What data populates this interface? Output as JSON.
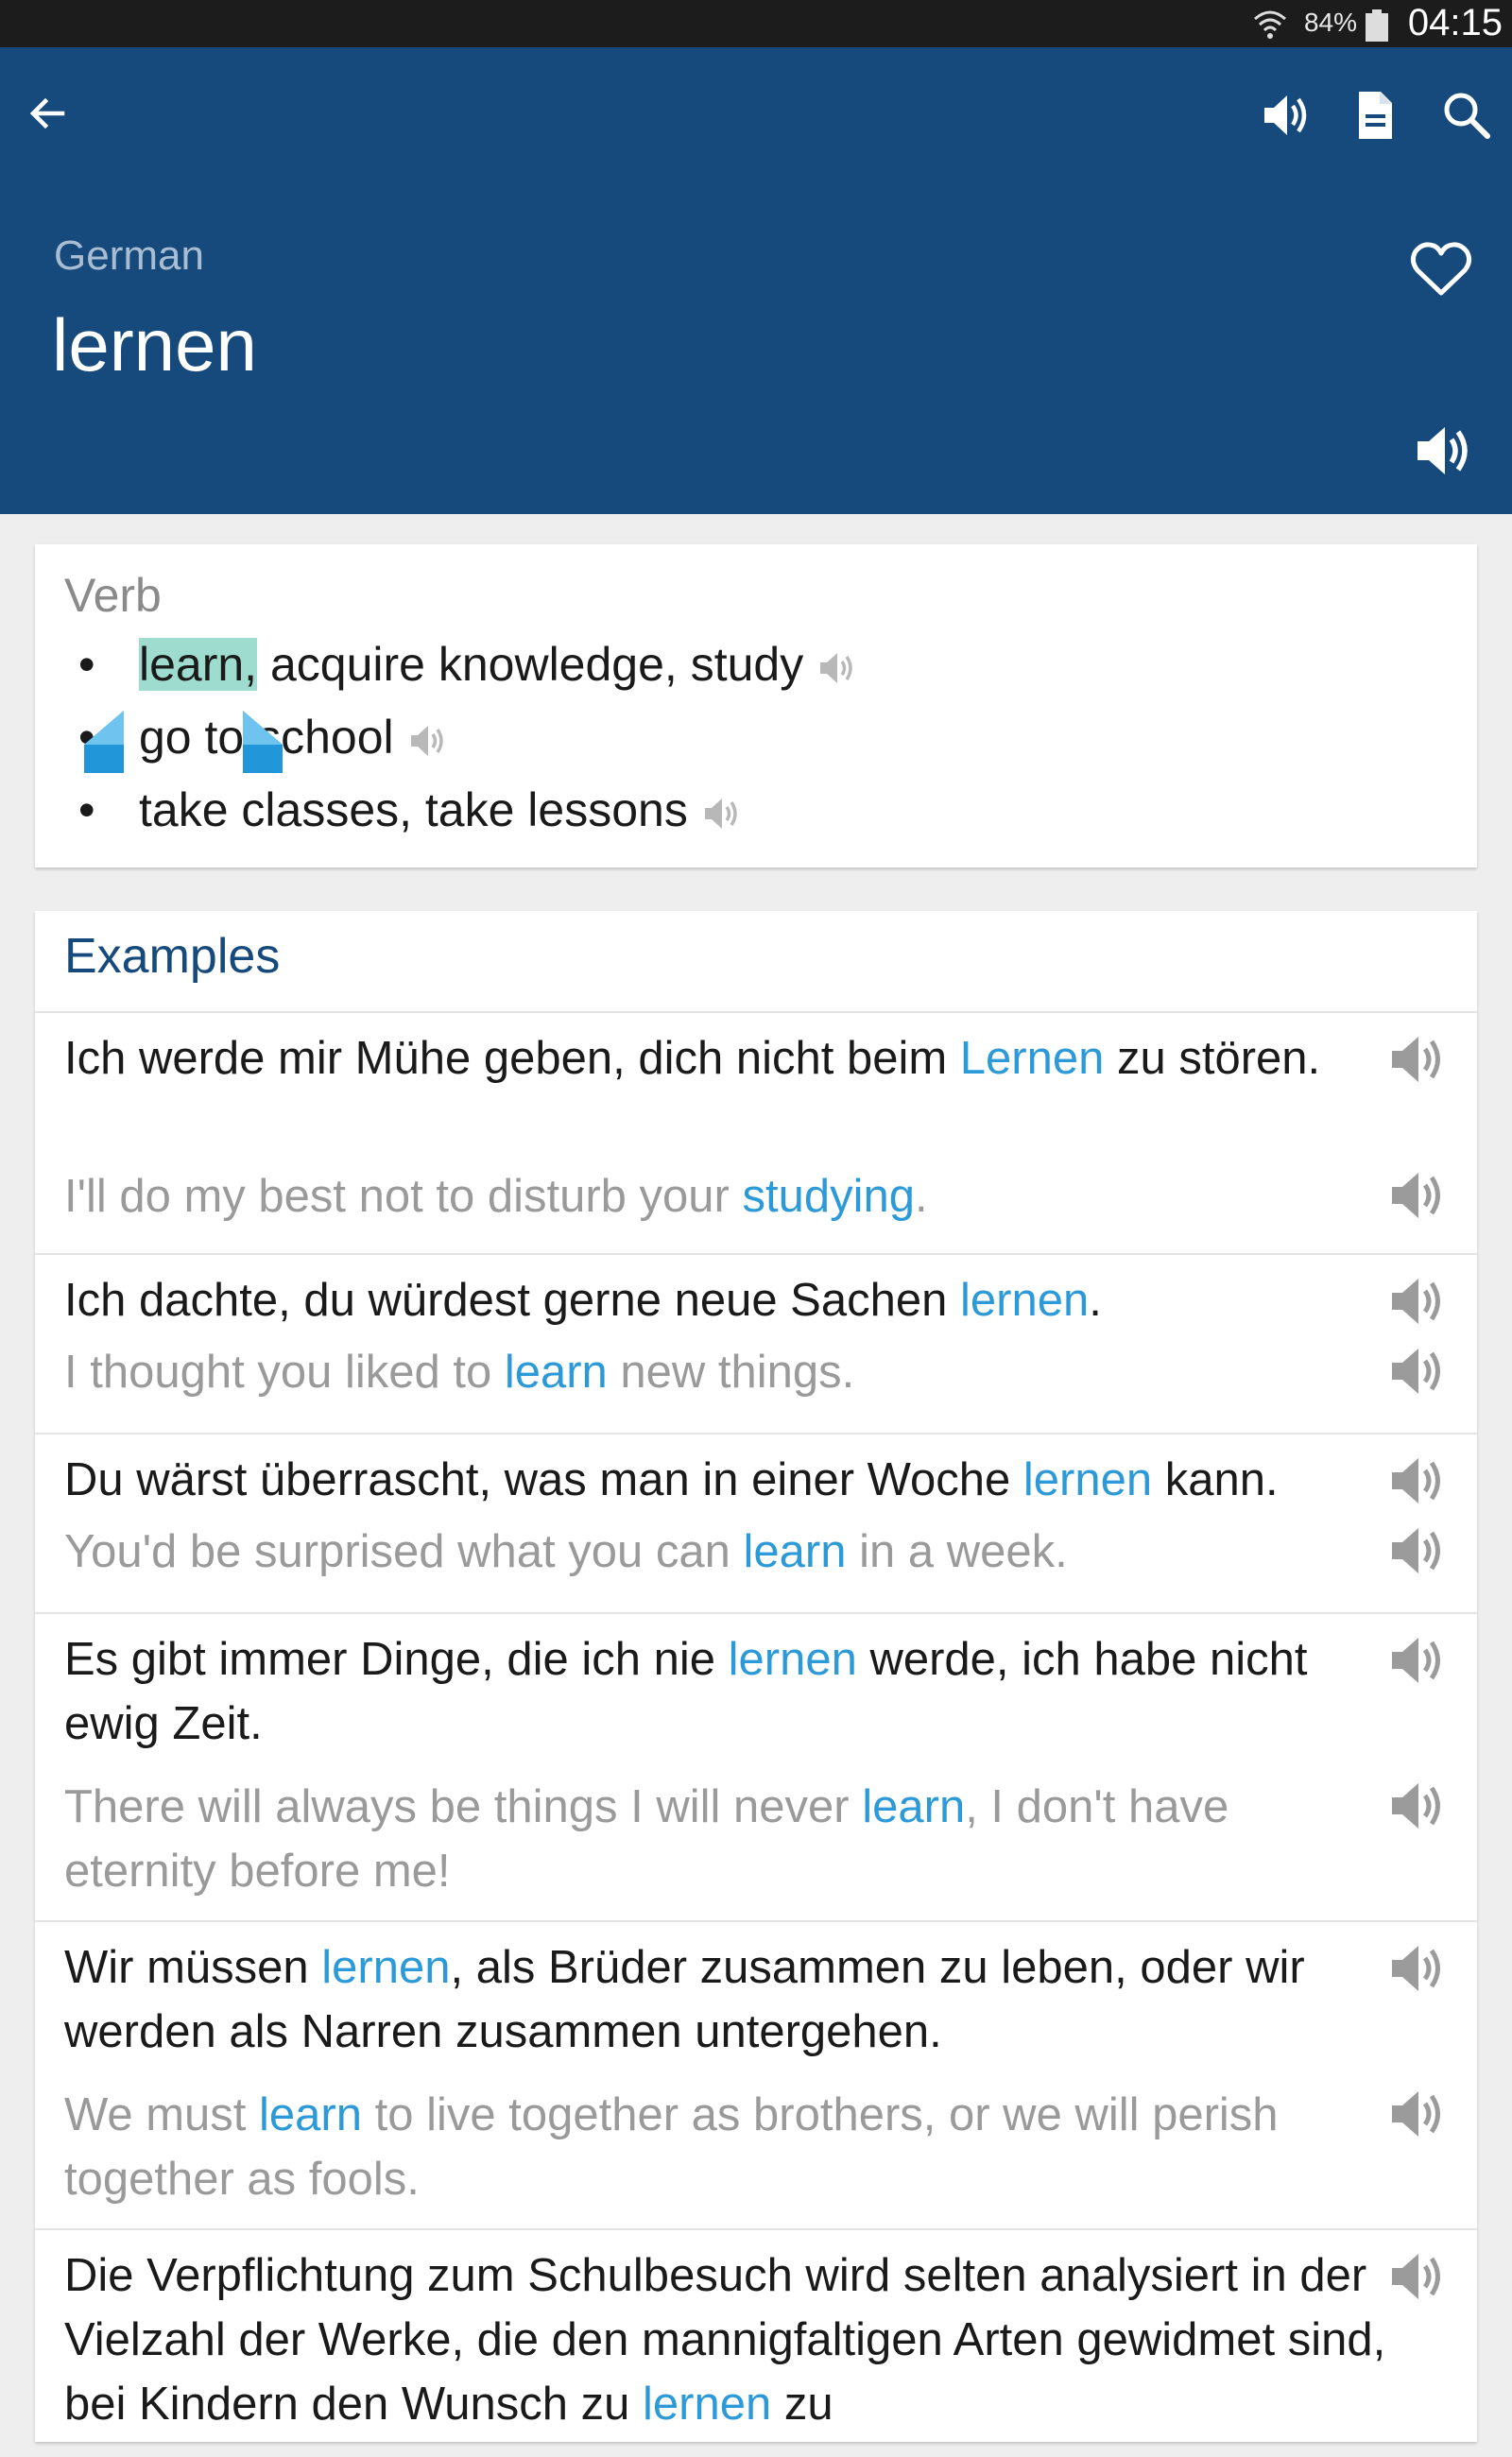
{
  "status_bar": {
    "battery_percent": "84%",
    "time": "04:15",
    "icons": [
      "wifi-icon",
      "battery-icon"
    ]
  },
  "toolbar": {
    "icons": [
      "back-arrow-icon",
      "speaker-icon",
      "document-icon",
      "search-icon"
    ]
  },
  "entry": {
    "language": "German",
    "word": "lernen",
    "icons": [
      "heart-outline-icon",
      "speaker-icon"
    ]
  },
  "meanings": {
    "part_of_speech": "Verb",
    "senses": [
      {
        "highlighted": "learn,",
        "rest": " acquire knowledge, study"
      },
      {
        "highlighted": "",
        "rest": "go to school"
      },
      {
        "highlighted": "",
        "rest": "take classes, take lessons"
      }
    ]
  },
  "examples": {
    "title": "Examples",
    "items": [
      {
        "de": [
          {
            "t": "Ich werde mir Mühe geben, dich nicht beim "
          },
          {
            "t": "Lernen",
            "k": true
          },
          {
            "t": " zu stören."
          }
        ],
        "en": [
          {
            "t": "I'll do my best not to disturb your "
          },
          {
            "t": "studying",
            "k": true
          },
          {
            "t": "."
          }
        ]
      },
      {
        "de": [
          {
            "t": "Ich dachte, du würdest gerne neue Sachen "
          },
          {
            "t": "lernen",
            "k": true
          },
          {
            "t": "."
          }
        ],
        "en": [
          {
            "t": "I thought you liked to "
          },
          {
            "t": "learn",
            "k": true
          },
          {
            "t": " new things."
          }
        ]
      },
      {
        "de": [
          {
            "t": "Du wärst überrascht, was man in einer Woche "
          },
          {
            "t": "lernen",
            "k": true
          },
          {
            "t": " kann."
          }
        ],
        "en": [
          {
            "t": "You'd be surprised what you can "
          },
          {
            "t": "learn",
            "k": true
          },
          {
            "t": " in a week."
          }
        ]
      },
      {
        "de": [
          {
            "t": "Es gibt immer Dinge, die ich nie "
          },
          {
            "t": "lernen",
            "k": true
          },
          {
            "t": " werde, ich habe nicht ewig Zeit."
          }
        ],
        "en": [
          {
            "t": "There will always be things I will never "
          },
          {
            "t": "learn",
            "k": true
          },
          {
            "t": ", I don't have eternity before me!"
          }
        ]
      },
      {
        "de": [
          {
            "t": "Wir müssen "
          },
          {
            "t": "lernen",
            "k": true
          },
          {
            "t": ", als Brüder zusammen zu leben, oder wir werden als Narren zusammen untergehen."
          }
        ],
        "en": [
          {
            "t": "We must "
          },
          {
            "t": "learn",
            "k": true
          },
          {
            "t": " to live together as brothers, or we will perish together as fools."
          }
        ]
      },
      {
        "de": [
          {
            "t": "Die Verpflichtung zum Schulbesuch wird selten analysiert in der Vielzahl der Werke, die den mannigfaltigen Arten gewidmet sind, bei Kindern den Wunsch zu "
          },
          {
            "t": "lernen",
            "k": true
          },
          {
            "t": " zu"
          }
        ],
        "en": []
      }
    ]
  },
  "colors": {
    "app_bar": "#174a7c",
    "status_bar": "#1c1c1c",
    "keyword": "#2c9ad9",
    "highlight": "#9fdcd0",
    "selection_handle": "#2196d8"
  }
}
